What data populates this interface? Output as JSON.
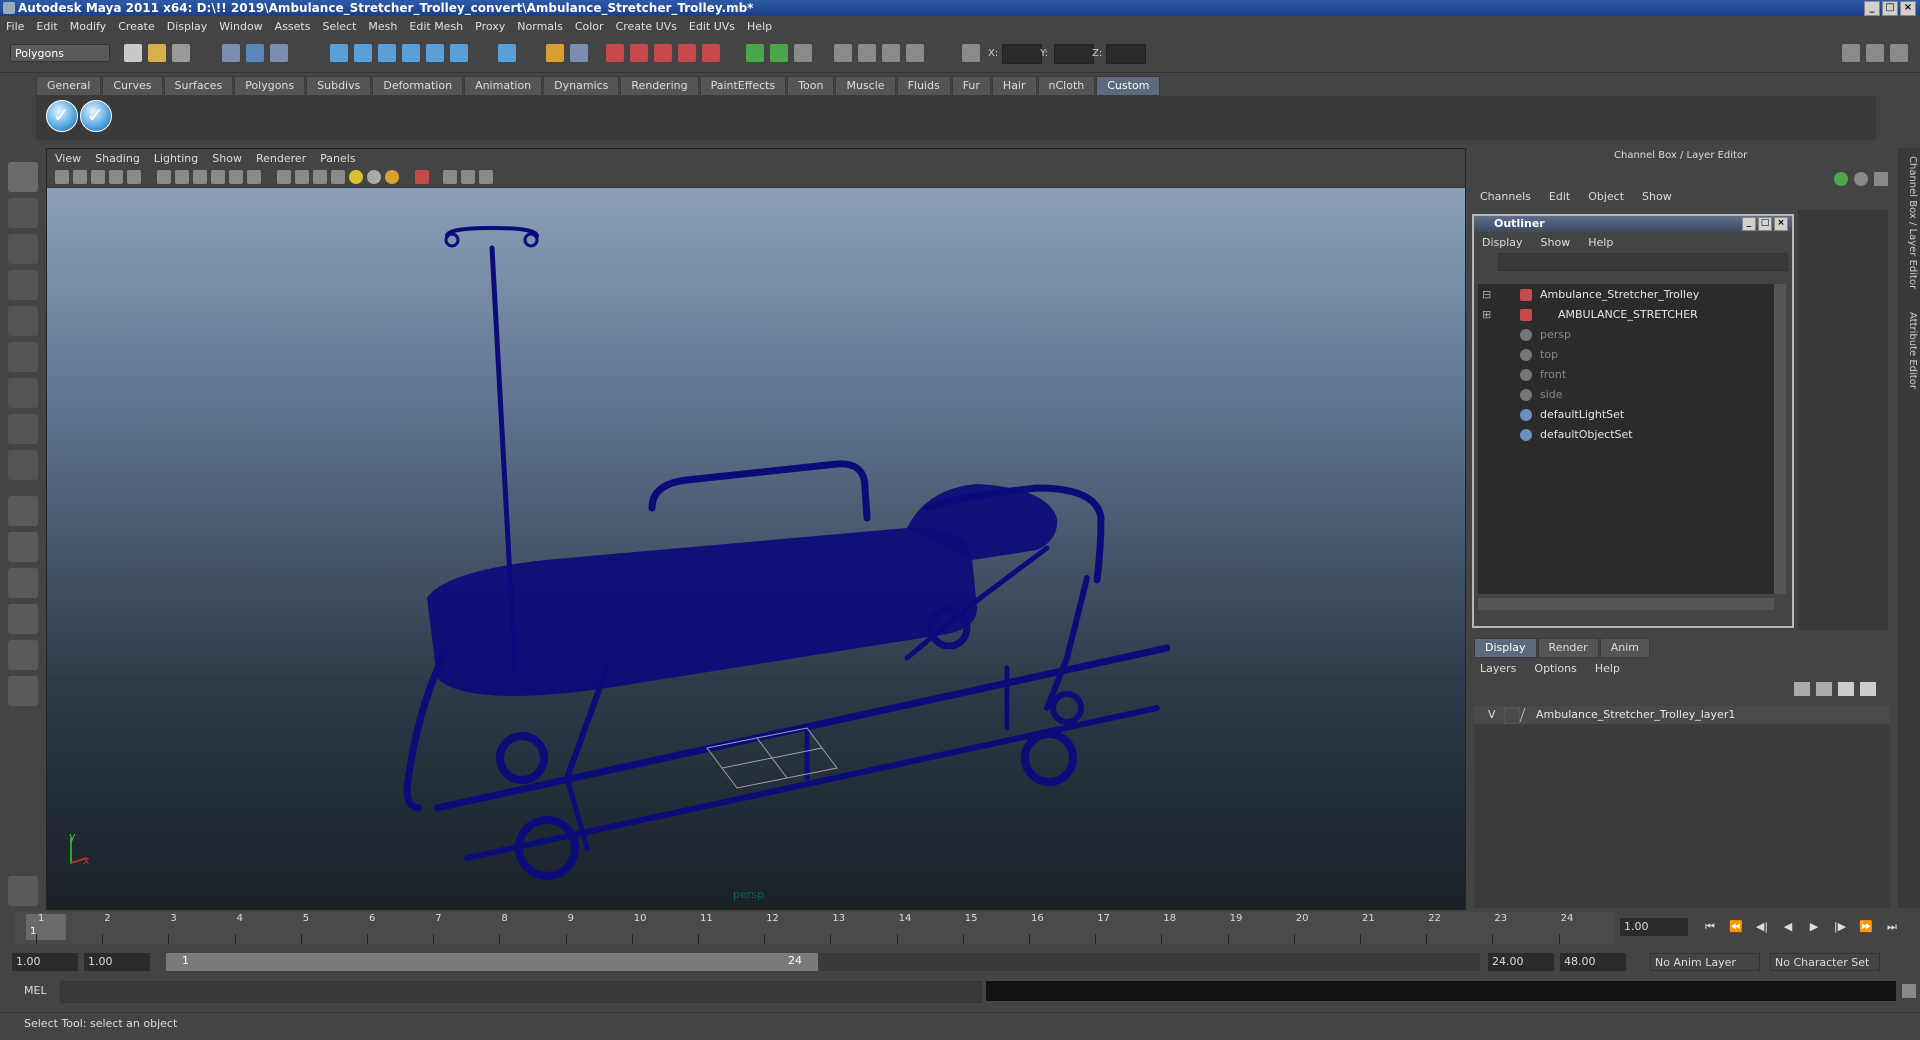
{
  "window": {
    "title": "Autodesk Maya 2011 x64: D:\\!! 2019\\Ambulance_Stretcher_Trolley_convert\\Ambulance_Stretcher_Trolley.mb*"
  },
  "menubar": [
    "File",
    "Edit",
    "Modify",
    "Create",
    "Display",
    "Window",
    "Assets",
    "Select",
    "Mesh",
    "Edit Mesh",
    "Proxy",
    "Normals",
    "Color",
    "Create UVs",
    "Edit UVs",
    "Help"
  ],
  "statusline": {
    "mode": "Polygons",
    "x_label": "X:",
    "y_label": "Y:",
    "z_label": "Z:"
  },
  "shelf_tabs": [
    "General",
    "Curves",
    "Surfaces",
    "Polygons",
    "Subdivs",
    "Deformation",
    "Animation",
    "Dynamics",
    "Rendering",
    "PaintEffects",
    "Toon",
    "Muscle",
    "Fluids",
    "Fur",
    "Hair",
    "nCloth",
    "Custom"
  ],
  "shelf_active": "Custom",
  "viewport": {
    "menu": [
      "View",
      "Shading",
      "Lighting",
      "Show",
      "Renderer",
      "Panels"
    ],
    "camera": "persp",
    "axis_y": "y",
    "axis_x": "x"
  },
  "channel_box": {
    "title": "Channel Box / Layer Editor",
    "menu": [
      "Channels",
      "Edit",
      "Object",
      "Show"
    ]
  },
  "outliner": {
    "title": "Outliner",
    "menu": [
      "Display",
      "Show",
      "Help"
    ],
    "items": [
      {
        "label": "Ambulance_Stretcher_Trolley",
        "dim": false
      },
      {
        "label": "AMBULANCE_STRETCHER",
        "dim": false
      },
      {
        "label": "persp",
        "dim": true
      },
      {
        "label": "top",
        "dim": true
      },
      {
        "label": "front",
        "dim": true
      },
      {
        "label": "side",
        "dim": true
      },
      {
        "label": "defaultLightSet",
        "dim": false
      },
      {
        "label": "defaultObjectSet",
        "dim": false
      }
    ]
  },
  "layer_editor": {
    "tabs": [
      "Display",
      "Render",
      "Anim"
    ],
    "active_tab": "Display",
    "menu": [
      "Layers",
      "Options",
      "Help"
    ],
    "layer_visible": "V",
    "layer_name": "Ambulance_Stretcher_Trolley_layer1"
  },
  "side_tabs": [
    "Channel Box / Layer Editor",
    "Attribute Editor"
  ],
  "timeline": {
    "ticks": [
      "1",
      "2",
      "3",
      "4",
      "5",
      "6",
      "7",
      "8",
      "9",
      "10",
      "11",
      "12",
      "13",
      "14",
      "15",
      "16",
      "17",
      "18",
      "19",
      "20",
      "21",
      "22",
      "23",
      "24"
    ],
    "current_frame_label": "1",
    "current_time": "1.00"
  },
  "range": {
    "start": "1.00",
    "playback_start": "1.00",
    "slider_start": "1",
    "slider_end": "24",
    "playback_end": "24.00",
    "end": "48.00",
    "anim_layer": "No Anim Layer",
    "character_set": "No Character Set"
  },
  "command_line": {
    "label": "MEL"
  },
  "status": {
    "help_line": "Select Tool: select an object"
  },
  "colors": {
    "wireframe": "#0b0b7a",
    "viewport_top": "#8ba0b8",
    "viewport_bottom": "#1a2128"
  }
}
